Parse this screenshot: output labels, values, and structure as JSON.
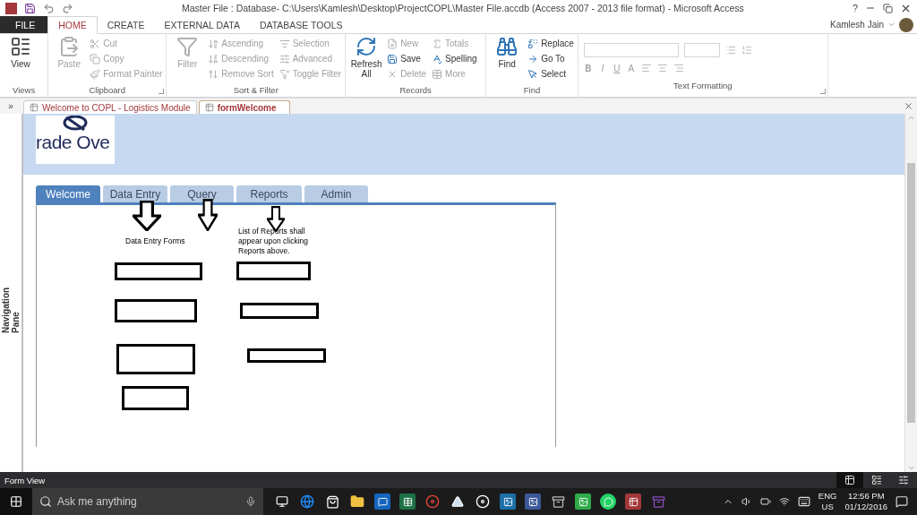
{
  "window": {
    "title": "Master File : Database- C:\\Users\\Kamlesh\\Desktop\\ProjectCOPL\\Master File.accdb (Access 2007 - 2013 file format) - Microsoft Access",
    "help": "?",
    "user": "Kamlesh Jain"
  },
  "ribbon_tabs": [
    {
      "label": "FILE",
      "kind": "file",
      "selected": false
    },
    {
      "label": "HOME",
      "kind": "tab",
      "selected": true
    },
    {
      "label": "CREATE",
      "kind": "tab",
      "selected": false
    },
    {
      "label": "EXTERNAL DATA",
      "kind": "tab",
      "selected": false
    },
    {
      "label": "DATABASE TOOLS",
      "kind": "tab",
      "selected": false
    }
  ],
  "ribbon_groups": [
    {
      "label": "Views",
      "kind": "buttons",
      "items": [
        {
          "label": "View",
          "kind": "large",
          "disabled": false
        }
      ]
    },
    {
      "label": "Clipboard",
      "kind": "buttons",
      "launcher": true,
      "items": [
        {
          "label": "Paste",
          "kind": "large",
          "disabled": true
        },
        {
          "label": "Cut",
          "kind": "small",
          "disabled": true
        },
        {
          "label": "Copy",
          "kind": "small",
          "disabled": true
        },
        {
          "label": "Format Painter",
          "kind": "small",
          "disabled": true
        }
      ]
    },
    {
      "label": "Sort & Filter",
      "kind": "buttons",
      "items": [
        {
          "label": "Filter",
          "kind": "large",
          "disabled": true
        },
        {
          "label": "Ascending",
          "kind": "small",
          "disabled": true
        },
        {
          "label": "Descending",
          "kind": "small",
          "disabled": true
        },
        {
          "label": "Remove Sort",
          "kind": "small",
          "disabled": true
        },
        {
          "label": "Selection",
          "kind": "small",
          "disabled": true
        },
        {
          "label": "Advanced",
          "kind": "small",
          "disabled": true
        },
        {
          "label": "Toggle Filter",
          "kind": "small",
          "disabled": true
        }
      ]
    },
    {
      "label": "Records",
      "kind": "buttons",
      "items": [
        {
          "label": "Refresh All",
          "kind": "large",
          "disabled": false
        },
        {
          "label": "New",
          "kind": "small",
          "disabled": true
        },
        {
          "label": "Save",
          "kind": "small",
          "disabled": false
        },
        {
          "label": "Delete",
          "kind": "small",
          "disabled": true
        },
        {
          "label": "Totals",
          "kind": "small",
          "disabled": true
        },
        {
          "label": "Spelling",
          "kind": "small",
          "disabled": false
        },
        {
          "label": "More",
          "kind": "small",
          "disabled": true
        }
      ]
    },
    {
      "label": "Find",
      "kind": "buttons",
      "items": [
        {
          "label": "Find",
          "kind": "large",
          "disabled": false
        },
        {
          "label": "Replace",
          "kind": "small",
          "disabled": false
        },
        {
          "label": "Go To",
          "kind": "small",
          "disabled": false
        },
        {
          "label": "Select",
          "kind": "small",
          "disabled": false
        }
      ]
    },
    {
      "label": "Text Formatting",
      "kind": "formatting",
      "launcher": true,
      "items": [
        {
          "label": "B",
          "disabled": true
        },
        {
          "label": "I",
          "disabled": true
        },
        {
          "label": "U",
          "disabled": true
        },
        {
          "label": "A",
          "disabled": true
        }
      ]
    }
  ],
  "document_tabs": [
    {
      "label": "Welcome to COPL - Logistics Module",
      "selected": false
    },
    {
      "label": "formWelcome",
      "selected": true
    }
  ],
  "navigation_pane": {
    "toggle": "»",
    "label": "Navigation Pane"
  },
  "form": {
    "logo_text": "rade Ove",
    "tabs": [
      {
        "label": "Welcome",
        "selected": true
      },
      {
        "label": "Data Entry",
        "selected": false
      },
      {
        "label": "Query",
        "selected": false
      },
      {
        "label": "Reports",
        "selected": false
      },
      {
        "label": "Admin",
        "selected": false
      }
    ],
    "labels": [
      {
        "text": "Data Entry Forms",
        "kind": "forms"
      },
      {
        "text": "List of Reports shall appear upon clicking Reports above.",
        "kind": "reports"
      }
    ]
  },
  "status_bar": {
    "text": "Form View"
  },
  "taskbar": {
    "search_placeholder": "Ask me anything",
    "language": "ENG",
    "region": "US",
    "time": "12:56 PM",
    "date": "01/12/2016"
  }
}
